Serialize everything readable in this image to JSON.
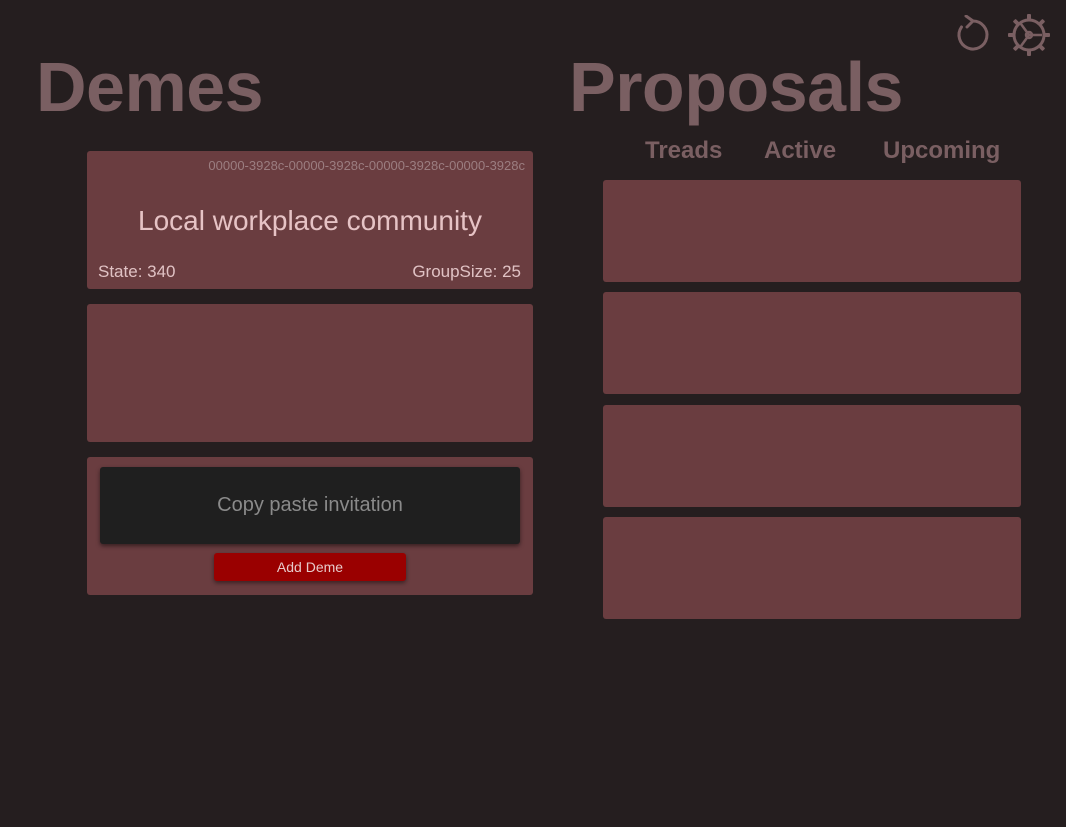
{
  "demes": {
    "title": "Demes",
    "cards": [
      {
        "id": "00000-3928c-00000-3928c-00000-3928c-00000-3928c",
        "name": "Local workplace community",
        "state": "State: 340",
        "group_size": "GroupSize: 25"
      }
    ],
    "invitation": {
      "placeholder": "Copy paste invitation",
      "value": ""
    },
    "add_button_label": "Add Deme"
  },
  "proposals": {
    "title": "Proposals",
    "tabs": [
      {
        "label": "Treads"
      },
      {
        "label": "Active"
      },
      {
        "label": "Upcoming"
      }
    ],
    "items": [
      {},
      {},
      {},
      {}
    ]
  },
  "toolbar": {
    "refresh_icon": "refresh-icon",
    "settings_icon": "gear-icon"
  },
  "colors": {
    "background": "#251e1f",
    "card": "#6a3d40",
    "heading": "#7a5f62",
    "accent_button": "#9a0000",
    "input_background": "#1f1f1f"
  }
}
